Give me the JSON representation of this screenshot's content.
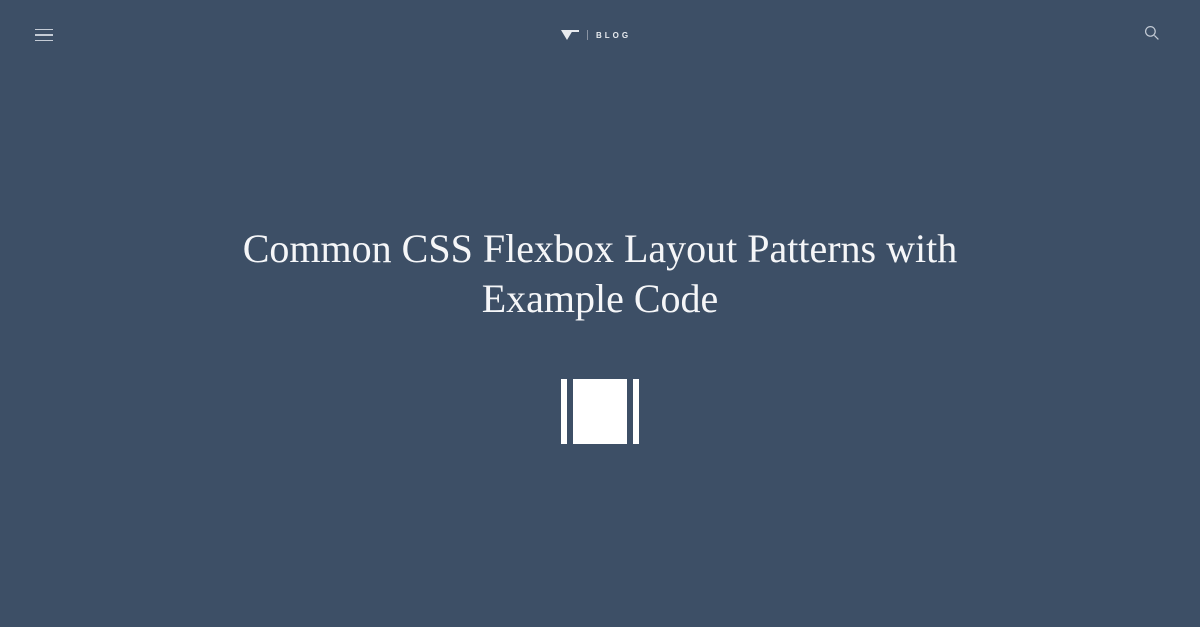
{
  "header": {
    "logo_text": "BLOG"
  },
  "main": {
    "title": "Common CSS Flexbox Layout Patterns with Example Code"
  }
}
